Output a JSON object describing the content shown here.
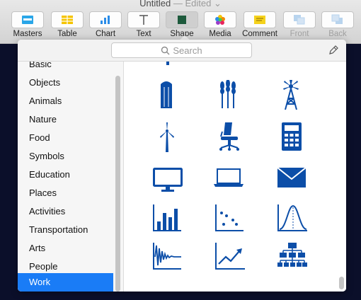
{
  "window": {
    "title": "Untitled",
    "edited": "— Edited",
    "chevron": "chevron-down-icon"
  },
  "toolbar": {
    "buttons": [
      {
        "label": "Masters",
        "icon": "masters-icon"
      },
      {
        "label": "Table",
        "icon": "table-icon"
      },
      {
        "label": "Chart",
        "icon": "chart-icon"
      },
      {
        "label": "Text",
        "icon": "text-icon"
      },
      {
        "label": "Shape",
        "icon": "shape-icon"
      },
      {
        "label": "Media",
        "icon": "media-icon"
      },
      {
        "label": "Comment",
        "icon": "comment-icon"
      },
      {
        "label": "Front",
        "icon": "front-icon"
      },
      {
        "label": "Back",
        "icon": "back-icon"
      }
    ]
  },
  "popover": {
    "search_placeholder": "Search",
    "categories": [
      "Basic",
      "Objects",
      "Animals",
      "Nature",
      "Food",
      "Symbols",
      "Education",
      "Places",
      "Activities",
      "Transportation",
      "Arts",
      "People",
      "Work"
    ],
    "selected_category": "Work",
    "shapes": [
      "grain-silo-icon",
      "wheat-icon",
      "windmill-icon",
      "wind-turbine-icon",
      "office-chair-icon",
      "calculator-icon",
      "monitor-icon",
      "laptop-icon",
      "envelope-icon",
      "bar-chart-icon",
      "scatter-plot-icon",
      "bell-curve-icon",
      "oscillation-graph-icon",
      "trend-up-icon",
      "org-chart-icon"
    ]
  },
  "colors": {
    "accent": "#1a7cf6",
    "shape_blue": "#0c4ea8",
    "desktop": "#0b0f2a"
  }
}
